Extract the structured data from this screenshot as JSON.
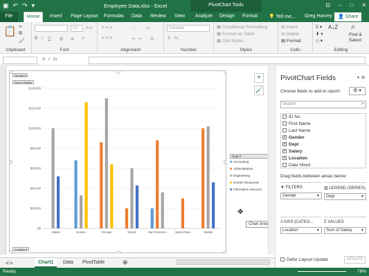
{
  "titlebar": {
    "doc_title": "Employee Data.xlsx - Excel",
    "context": "PivotChart Tools"
  },
  "tabs": {
    "file": "File",
    "home": "Home",
    "insert": "Insert",
    "layout": "Page Layout",
    "formulas": "Formulas",
    "data": "Data",
    "review": "Review",
    "view": "View",
    "analyze": "Analyze",
    "design": "Design",
    "format": "Format",
    "tell": "Tell me...",
    "user": "Greg Harvey",
    "share": "Share"
  },
  "ribbon": {
    "clipboard": "Clipboard",
    "font": "Font",
    "alignment": "Alignment",
    "number": "Number",
    "styles": "Styles",
    "cells": "Cells",
    "editing": "Editing",
    "font_size": "10",
    "number_format": "General",
    "dollar": "$ - % ,",
    "cond_fmt": "Conditional Formatting",
    "fmt_table": "Format as Table",
    "cell_styles": "Cell Styles",
    "insert": "Insert",
    "delete": "Delete",
    "format": "Format",
    "find": "Find &",
    "select": "Select"
  },
  "formula": {
    "fx": "fx"
  },
  "chart": {
    "filter_gender": "Gender",
    "sum_label": "Sum of Salary",
    "axis_btn": "Location",
    "legend_title": "Dept",
    "tooltip": "Chart Area"
  },
  "chart_data": {
    "type": "bar",
    "categories": [
      "Atlanta",
      "Boston",
      "Chicago",
      "Detroit",
      "San Francisco",
      "Santa Rosa",
      "Seattle"
    ],
    "ylim": [
      0,
      140000
    ],
    "ytick_labels": [
      "$0",
      "$20,000",
      "$40,000",
      "$60,000",
      "$80,000",
      "$100,000",
      "$120,000",
      "$140,000"
    ],
    "series": [
      {
        "name": "Accounting",
        "color": "#5b9bd5",
        "values": [
          null,
          68000,
          null,
          null,
          20000,
          null,
          null
        ]
      },
      {
        "name": "Administration",
        "color": "#ed7d31",
        "values": [
          null,
          null,
          86000,
          20000,
          88000,
          30000,
          100000
        ]
      },
      {
        "name": "Engineering",
        "color": "#a5a5a5",
        "values": [
          100000,
          33000,
          130000,
          60000,
          36000,
          null,
          102000
        ]
      },
      {
        "name": "Human Resources",
        "color": "#ffc000",
        "values": [
          null,
          126000,
          64000,
          null,
          null,
          null,
          null
        ]
      },
      {
        "name": "Information Services",
        "color": "#4472c4",
        "values": [
          52000,
          null,
          null,
          43000,
          null,
          null,
          46000
        ]
      }
    ]
  },
  "sheets": {
    "chart1": "Chart1",
    "data": "Data",
    "pivot": "PivotTable"
  },
  "status": {
    "ready": "Ready",
    "zoom": "78%"
  },
  "pane": {
    "title": "PivotChart Fields",
    "choose": "Choose fields to add to report:",
    "search_ph": "Search",
    "fields": [
      {
        "label": "ID No",
        "checked": false
      },
      {
        "label": "First Name",
        "checked": false
      },
      {
        "label": "Last Name",
        "checked": false
      },
      {
        "label": "Gender",
        "checked": true
      },
      {
        "label": "Dept",
        "checked": true
      },
      {
        "label": "Salary",
        "checked": true
      },
      {
        "label": "Location",
        "checked": true
      },
      {
        "label": "Date Hired",
        "checked": false
      }
    ],
    "drag": "Drag fields between areas below:",
    "filters": "FILTERS",
    "filters_val": "Gender",
    "legend": "LEGEND (SERIES)",
    "legend_val": "Dept",
    "axis": "AXIS (CATEG...",
    "axis_val": "Location",
    "values": "VALUES",
    "values_val": "Sum of Salary",
    "defer": "Defer Layout Update",
    "update": "UPDATE"
  }
}
